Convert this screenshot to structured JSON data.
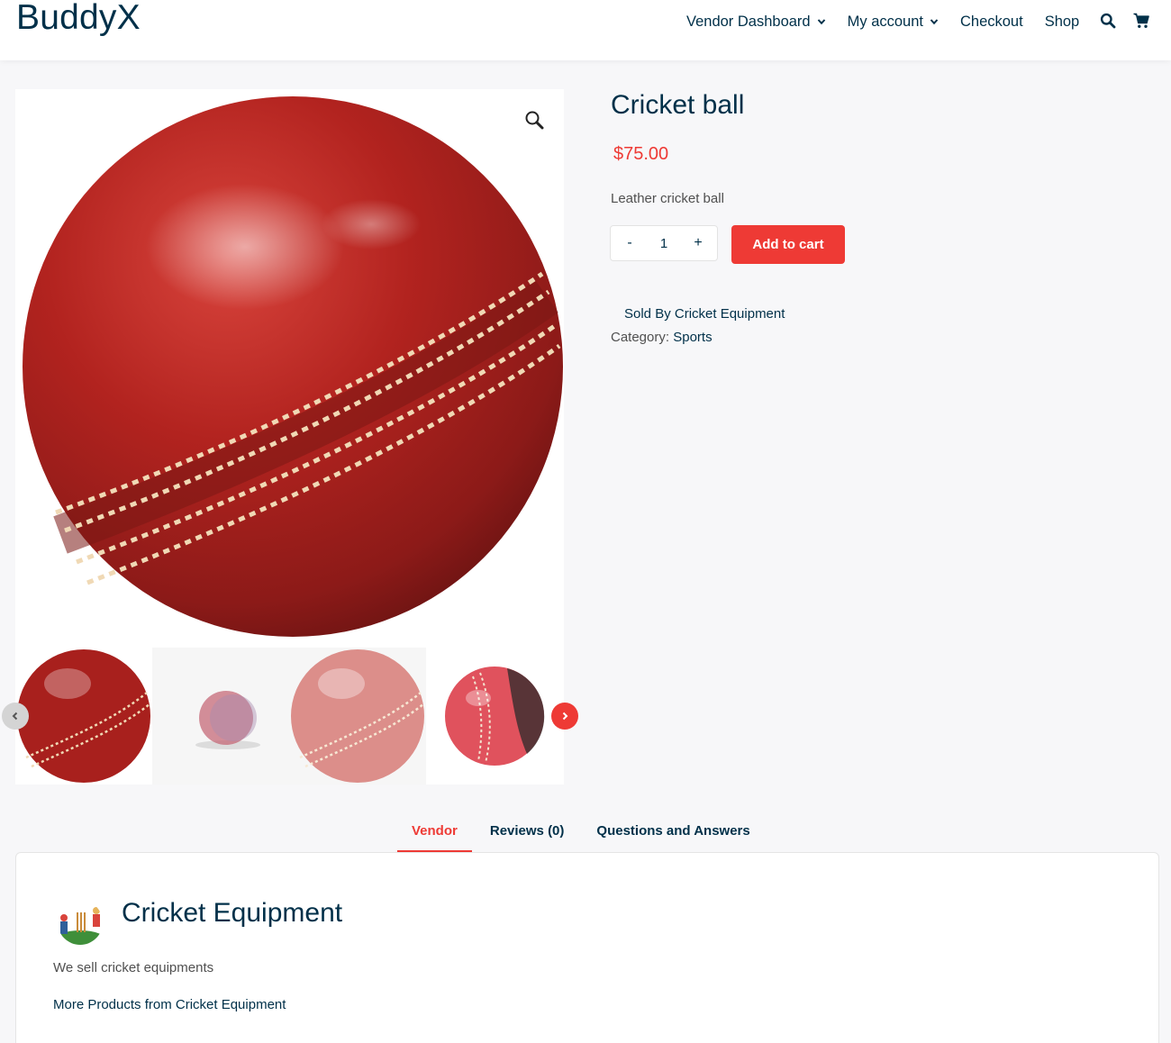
{
  "header": {
    "logo": "BuddyX",
    "nav": [
      {
        "label": "Vendor Dashboard",
        "has_dropdown": true
      },
      {
        "label": "My account",
        "has_dropdown": true
      },
      {
        "label": "Checkout",
        "has_dropdown": false
      },
      {
        "label": "Shop",
        "has_dropdown": false
      }
    ],
    "icons": [
      "search-icon",
      "cart-icon"
    ]
  },
  "gallery": {
    "thumbnail_count": 4,
    "icons": [
      "zoom-icon",
      "chevron-left-icon",
      "chevron-right-icon"
    ]
  },
  "product": {
    "title": "Cricket ball",
    "price": "$75.00",
    "short_description": "Leather cricket ball",
    "quantity": "1",
    "qty_minus": "-",
    "qty_plus": "+",
    "add_to_cart_label": "Add to cart",
    "sold_by": "Sold By Cricket Equipment",
    "category_label": "Category:",
    "category_value": "Sports"
  },
  "tabs": [
    {
      "label": "Vendor",
      "active": true
    },
    {
      "label": "Reviews (0)",
      "active": false
    },
    {
      "label": "Questions and Answers",
      "active": false
    }
  ],
  "vendor": {
    "name": "Cricket Equipment",
    "description": "We sell cricket equipments",
    "more_link": "More Products from Cricket Equipment"
  },
  "colors": {
    "accent": "#ee3a35",
    "text_dark": "#003049",
    "page_bg": "#f7f7f9"
  }
}
